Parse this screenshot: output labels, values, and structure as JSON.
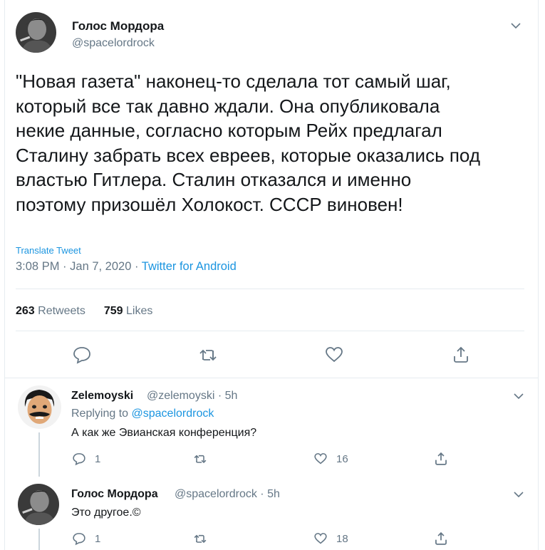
{
  "main_tweet": {
    "author_name": "Голос Мордора",
    "author_handle": "@spacelordrock",
    "text": "\"Новая газета\" наконец-то сделала тот самый шаг,\nкоторый все так давно ждали. Она опубликовала\nнекие данные, согласно которым Рейх предлагал\nСталину забрать всех евреев, которые оказались под\nвластью Гитлера. Сталин отказался и именно\nпоэтому призошёл Холокост. СССР виновен!",
    "translate_label": "Translate Tweet",
    "time": "3:08 PM",
    "sep1": "·",
    "date": "Jan 7, 2020",
    "sep2": "·",
    "source": "Twitter for Android",
    "retweets_count": "263",
    "retweets_label": "Retweets",
    "likes_count": "759",
    "likes_label": "Likes"
  },
  "replies": [
    {
      "author_name": "Zelemoyski",
      "author_handle": "@zelemoyski · 5h",
      "replying_label": "Replying to",
      "replying_handle": "@spacelordrock",
      "text": "А как же Эвианская конференция?",
      "reply_count": "1",
      "retweet_count": "",
      "like_count": "16"
    },
    {
      "author_name": "Голос Мордора",
      "author_handle": "@spacelordrock · 5h",
      "text": "Это другое.©",
      "reply_count": "1",
      "retweet_count": "",
      "like_count": "18"
    }
  ],
  "colors": {
    "accent": "#1b95e0",
    "muted": "#657786",
    "text": "#14171a",
    "divider": "#e6ecf0"
  },
  "icons": [
    "chevron-down-icon",
    "reply-icon",
    "retweet-icon",
    "like-icon",
    "share-icon"
  ]
}
